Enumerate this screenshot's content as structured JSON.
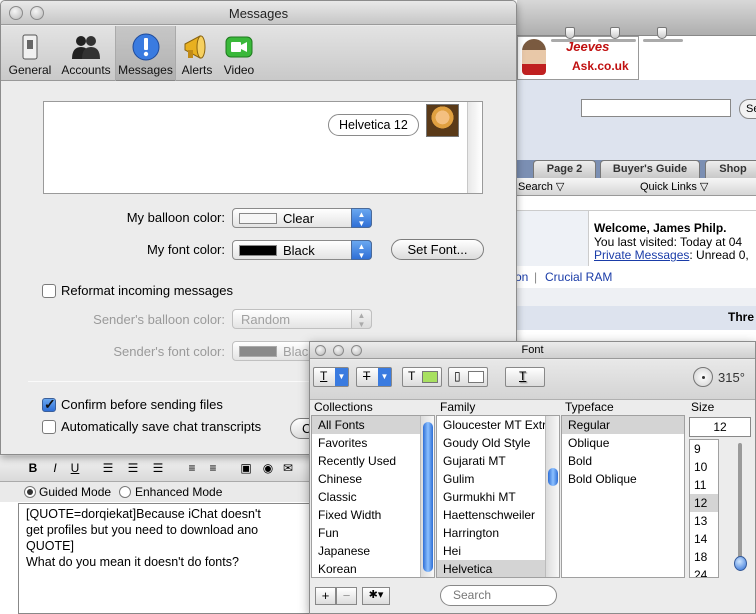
{
  "browser": {
    "ad_brand": "Jeeves",
    "ad_url": "Ask.co.uk",
    "search_button": "Se",
    "tabs": [
      "Page 2",
      "Buyer's Guide",
      "Shop"
    ],
    "nav_search": "Search ▽",
    "nav_quick_links": "Quick Links ▽",
    "welcome_title": "Welcome, James Philp.",
    "last_visited": "You last visited: Today at 04",
    "private_messages_link": "Private Messages",
    "private_messages_rest": ": Unread 0,",
    "crumb_left": "on",
    "crumb_link": "Crucial RAM",
    "thread_title": "Thre",
    "editor": {
      "mode_guided": "Guided Mode",
      "mode_enhanced": "Enhanced Mode",
      "lines": [
        "[QUOTE=dorqiekat]Because iChat doesn't",
        "get profiles but you need to download ano",
        "QUOTE]",
        "What do you mean it doesn't do fonts?"
      ]
    }
  },
  "prefs": {
    "title": "Messages",
    "toolbar": [
      {
        "label": "General",
        "icon": "switch-icon"
      },
      {
        "label": "Accounts",
        "icon": "people-icon"
      },
      {
        "label": "Messages",
        "icon": "exclamation-icon"
      },
      {
        "label": "Alerts",
        "icon": "megaphone-icon"
      },
      {
        "label": "Video",
        "icon": "camera-icon"
      }
    ],
    "preview_bubble": "Helvetica 12",
    "balloon_label": "My balloon color:",
    "balloon_value": "Clear",
    "font_color_label": "My font color:",
    "font_color_value": "Black",
    "set_font_button": "Set Font...",
    "reformat_label": "Reformat incoming messages",
    "sender_balloon_label": "Sender's balloon color:",
    "sender_balloon_value": "Random",
    "sender_font_label": "Sender's font color:",
    "sender_font_value": "Black",
    "confirm_label": "Confirm before sending files",
    "autosave_label": "Automatically save chat transcripts",
    "autosave_button_partial": "C",
    "colors": {
      "accent": "#2f6fd6",
      "black_swatch": "#000000",
      "gray_swatch": "#8a8a8a"
    }
  },
  "fontpanel": {
    "title": "Font",
    "angle": "315°",
    "headers": {
      "collections": "Collections",
      "family": "Family",
      "typeface": "Typeface",
      "size": "Size"
    },
    "collections": [
      "All Fonts",
      "Favorites",
      "Recently Used",
      "Chinese",
      "Classic",
      "Fixed Width",
      "Fun",
      "Japanese",
      "Korean"
    ],
    "families": [
      "Gloucester MT Extr",
      "Goudy Old Style",
      "Gujarati MT",
      "Gulim",
      "Gurmukhi MT",
      "Haettenschweiler",
      "Harrington",
      "Hei",
      "Helvetica"
    ],
    "typefaces": [
      "Regular",
      "Oblique",
      "Bold",
      "Bold Oblique"
    ],
    "size_value": "12",
    "sizes": [
      "9",
      "10",
      "11",
      "12",
      "13",
      "14",
      "18",
      "24"
    ],
    "add_button": "+",
    "remove_button": "−",
    "action_button": "✱▾",
    "search_placeholder": "Search"
  }
}
